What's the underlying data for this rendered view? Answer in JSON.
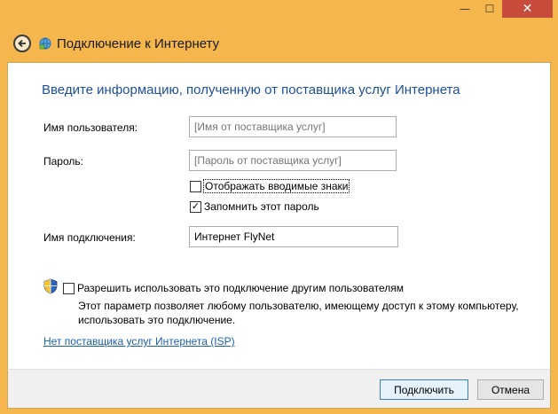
{
  "window": {
    "title": "Подключение к Интернету",
    "controls": {
      "minimize": "—",
      "maximize": "☐",
      "close": "✕"
    }
  },
  "form": {
    "heading": "Введите информацию, полученную от поставщика услуг Интернета",
    "username": {
      "label": "Имя пользователя:",
      "placeholder": "[Имя от поставщика услуг]",
      "value": ""
    },
    "password": {
      "label": "Пароль:",
      "placeholder": "[Пароль от поставщика услуг]",
      "value": ""
    },
    "show_chars": {
      "label": "Отображать вводимые знаки",
      "checked": false
    },
    "remember_password": {
      "label": "Запомнить этот пароль",
      "checked": true,
      "mark": "✓"
    },
    "connection_name": {
      "label": "Имя подключения:",
      "value": "Интернет FlyNet"
    },
    "allow_others": {
      "label": "Разрешить использовать это подключение другим пользователям",
      "checked": false,
      "description": "Этот параметр позволяет любому пользователю, имеющему доступ к этому компьютеру, использовать это подключение."
    },
    "no_isp_link": "Нет поставщика услуг Интернета (ISP)"
  },
  "footer": {
    "connect_label": "Подключить",
    "cancel_label": "Отмена"
  },
  "colors": {
    "frame": "#f5b64d",
    "heading": "#1d4f98",
    "link": "#1a5fb4",
    "close": "#c74c3c"
  },
  "icons": {
    "back": "back-arrow-icon",
    "network": "network-globe-icon",
    "uac": "uac-shield-icon"
  }
}
